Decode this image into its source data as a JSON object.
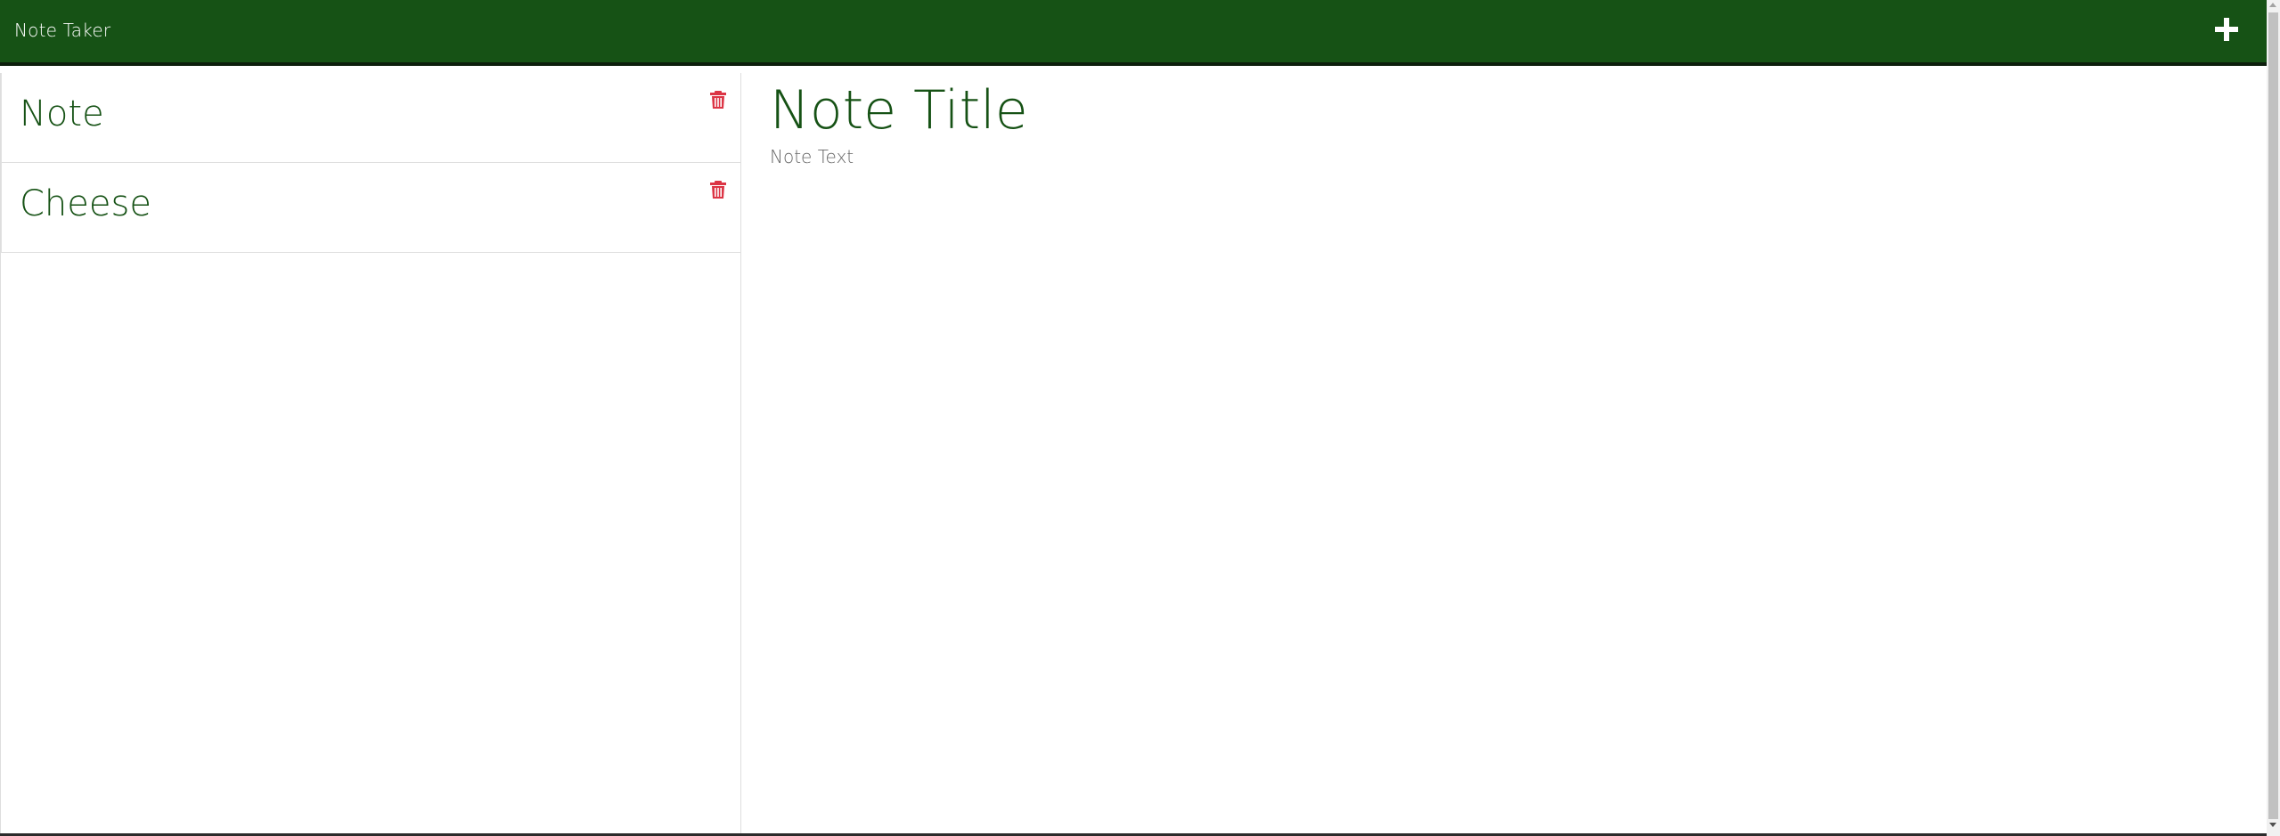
{
  "navbar": {
    "title": "Note Taker",
    "new_note_icon": "plus-icon",
    "background_color": "#165215"
  },
  "notes": [
    {
      "title": "Note",
      "delete_icon": "trash-icon"
    },
    {
      "title": "Cheese",
      "delete_icon": "trash-icon"
    }
  ],
  "editor": {
    "title_placeholder": "Note Title",
    "text_placeholder": "Note Text",
    "title_value": "",
    "text_value": ""
  },
  "colors": {
    "accent": "#165215",
    "delete": "#dc3545"
  }
}
